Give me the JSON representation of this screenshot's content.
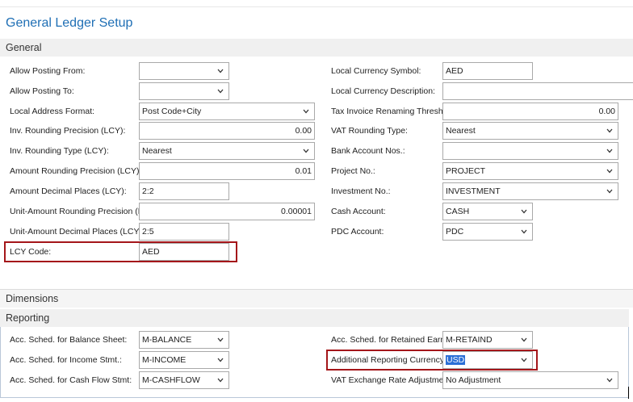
{
  "page_title": "General Ledger Setup",
  "sections": {
    "general": "General",
    "dimensions": "Dimensions",
    "reporting": "Reporting"
  },
  "general_left": [
    {
      "label": "Allow Posting From:",
      "value": "",
      "type": "dropdown"
    },
    {
      "label": "Allow Posting To:",
      "value": "",
      "type": "dropdown"
    },
    {
      "label": "Local Address Format:",
      "value": "Post Code+City",
      "type": "dropdown"
    },
    {
      "label": "Inv. Rounding Precision (LCY):",
      "value": "0.00",
      "type": "number"
    },
    {
      "label": "Inv. Rounding Type (LCY):",
      "value": "Nearest",
      "type": "dropdown"
    },
    {
      "label": "Amount Rounding Precision (LCY):",
      "value": "0.01",
      "type": "number"
    },
    {
      "label": "Amount Decimal Places (LCY):",
      "value": "2:2",
      "type": "text"
    },
    {
      "label": "Unit-Amount Rounding Precision (LCY):",
      "value": "0.00001",
      "type": "number"
    },
    {
      "label": "Unit-Amount Decimal Places (LCY):",
      "value": "2:5",
      "type": "text"
    },
    {
      "label": "LCY Code:",
      "value": "AED",
      "type": "text"
    }
  ],
  "general_right": [
    {
      "label": "Local Currency Symbol:",
      "value": "AED",
      "type": "text"
    },
    {
      "label": "Local Currency Description:",
      "value": "",
      "type": "text"
    },
    {
      "label": "Tax Invoice Renaming Threshold:",
      "value": "0.00",
      "type": "number"
    },
    {
      "label": "VAT Rounding Type:",
      "value": "Nearest",
      "type": "dropdown"
    },
    {
      "label": "Bank Account Nos.:",
      "value": "",
      "type": "dropdown"
    },
    {
      "label": "Project No.:",
      "value": "PROJECT",
      "type": "dropdown"
    },
    {
      "label": "Investment No.:",
      "value": "INVESTMENT",
      "type": "dropdown"
    },
    {
      "label": "Cash Account:",
      "value": "CASH",
      "type": "dropdown"
    },
    {
      "label": "PDC Account:",
      "value": "PDC",
      "type": "dropdown"
    }
  ],
  "reporting_left": [
    {
      "label": "Acc. Sched. for Balance Sheet:",
      "value": "M-BALANCE",
      "type": "dropdown"
    },
    {
      "label": "Acc. Sched. for Income Stmt.:",
      "value": "M-INCOME",
      "type": "dropdown"
    },
    {
      "label": "Acc. Sched. for Cash Flow Stmt:",
      "value": "M-CASHFLOW",
      "type": "dropdown"
    }
  ],
  "reporting_right": [
    {
      "label": "Acc. Sched. for Retained Earn.:",
      "value": "M-RETAIND",
      "type": "dropdown"
    },
    {
      "label": "Additional Reporting Currency:",
      "value": "USD",
      "type": "dropdown"
    },
    {
      "label": "VAT Exchange Rate Adjustment:",
      "value": "No Adjustment",
      "type": "dropdown"
    }
  ],
  "colors": {
    "title": "#1f6fb5",
    "highlight": "#a4161a",
    "selection": "#2b6fd6",
    "section_bg": "#f0f0f0"
  }
}
